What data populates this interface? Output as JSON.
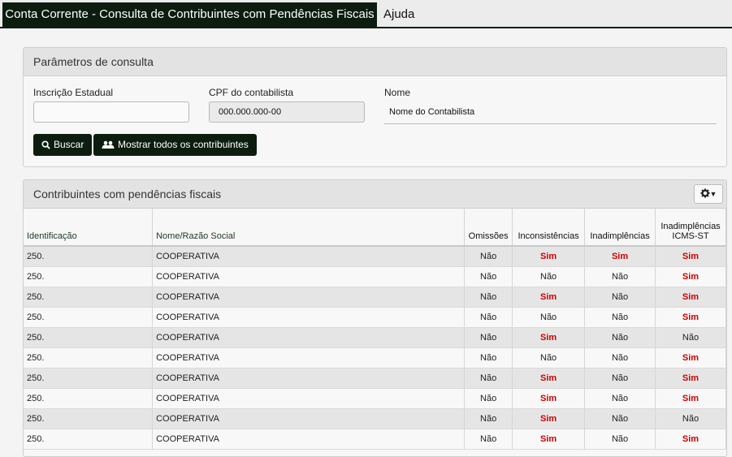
{
  "topbar": {
    "active_tab": "Conta Corrente - Consulta de Contribuintes com Pendências Fiscais",
    "help_tab": "Ajuda"
  },
  "params": {
    "title": "Parâmetros de consulta",
    "ie_label": "Inscrição Estadual",
    "ie_value": "",
    "cpf_label": "CPF do contabilista",
    "cpf_value": "000.000.000-00",
    "name_label": "Nome",
    "name_value": "Nome do Contabilista",
    "search_button": "Buscar",
    "show_all_button": "Mostrar todos os contribuintes"
  },
  "results": {
    "title": "Contribuintes com pendências fiscais",
    "columns": [
      "Identificação",
      "Nome/Razão Social",
      "Omissões",
      "Inconsistências",
      "Inadimplências",
      "Inadimplências ICMS-ST"
    ],
    "rows": [
      [
        "250.",
        "COOPERATIVA",
        "Não",
        "Sim",
        "Sim",
        "Sim"
      ],
      [
        "250.",
        "COOPERATIVA",
        "Não",
        "Não",
        "Não",
        "Sim"
      ],
      [
        "250.",
        "COOPERATIVA",
        "Não",
        "Sim",
        "Não",
        "Sim"
      ],
      [
        "250.",
        "COOPERATIVA",
        "Não",
        "Não",
        "Não",
        "Sim"
      ],
      [
        "250.",
        "COOPERATIVA",
        "Não",
        "Sim",
        "Não",
        "Não"
      ],
      [
        "250.",
        "COOPERATIVA",
        "Não",
        "Não",
        "Não",
        "Sim"
      ],
      [
        "250.",
        "COOPERATIVA",
        "Não",
        "Sim",
        "Não",
        "Sim"
      ],
      [
        "250.",
        "COOPERATIVA",
        "Não",
        "Sim",
        "Não",
        "Sim"
      ],
      [
        "250.",
        "COOPERATIVA",
        "Não",
        "Sim",
        "Não",
        "Não"
      ],
      [
        "250.",
        "COOPERATIVA",
        "Não",
        "Sim",
        "Não",
        "Sim"
      ]
    ]
  },
  "colors": {
    "brand_dark": "#0c1d10",
    "sim_red": "#cc0000"
  },
  "icons": {
    "search": "search-icon",
    "users": "users-icon",
    "settings": "gear-icon"
  }
}
